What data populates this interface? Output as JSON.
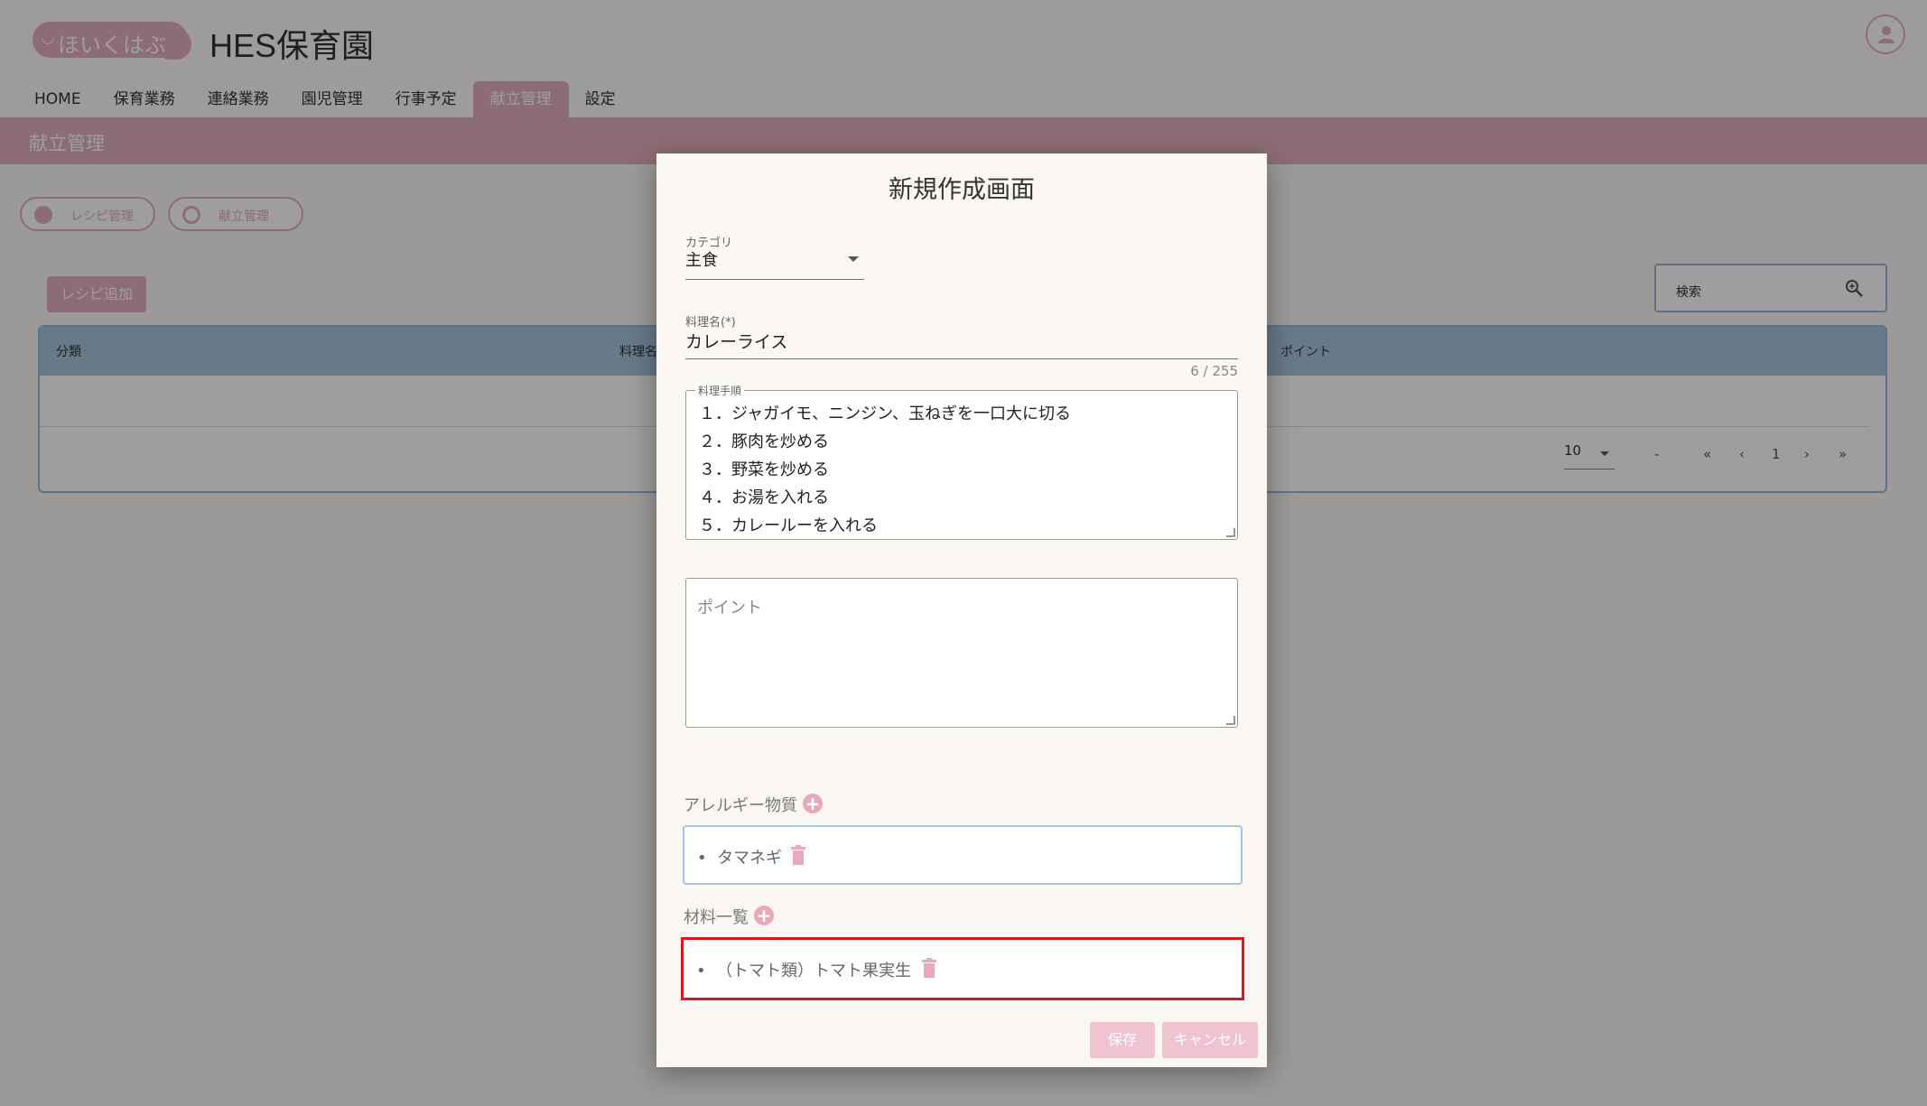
{
  "header": {
    "logo_text": "ほいくはぶ",
    "title": "HES保育園"
  },
  "nav": {
    "items": [
      {
        "label": "HOME"
      },
      {
        "label": "保育業務"
      },
      {
        "label": "連絡業務"
      },
      {
        "label": "園児管理"
      },
      {
        "label": "行事予定"
      },
      {
        "label": "献立管理",
        "active": true
      },
      {
        "label": "設定"
      }
    ]
  },
  "subbar": {
    "title": "献立管理"
  },
  "pills": {
    "recipe": "レシピ管理",
    "menu": "献立管理"
  },
  "add_button": "レシピ追加",
  "search": {
    "label": "検索"
  },
  "table": {
    "headers": [
      "分類",
      "料理名",
      "ポイント"
    ],
    "pager": {
      "per_page": "10",
      "range": "-",
      "page": "1"
    }
  },
  "dialog": {
    "title": "新規作成画面",
    "category": {
      "label": "カテゴリ",
      "value": "主食"
    },
    "dish_name": {
      "label": "料理名(*)",
      "value": "カレーライス",
      "counter": "6 / 255"
    },
    "steps": {
      "label": "料理手順",
      "lines": [
        "１．ジャガイモ、ニンジン、玉ねぎを一口大に切る",
        "２．豚肉を炒める",
        "３．野菜を炒める",
        "４．お湯を入れる",
        "５．カレールーを入れる"
      ]
    },
    "point": {
      "placeholder": "ポイント"
    },
    "allergy": {
      "label": "アレルギー物質",
      "items": [
        "タマネギ"
      ]
    },
    "materials": {
      "label": "材料一覧",
      "items": [
        "（トマト類）トマト果実生"
      ]
    },
    "buttons": {
      "save": "保存",
      "cancel": "キャンセル"
    }
  },
  "colors": {
    "brand_pink": "#e3aebd",
    "table_header_blue": "#a8c4de",
    "highlight_red": "#e0141e"
  }
}
